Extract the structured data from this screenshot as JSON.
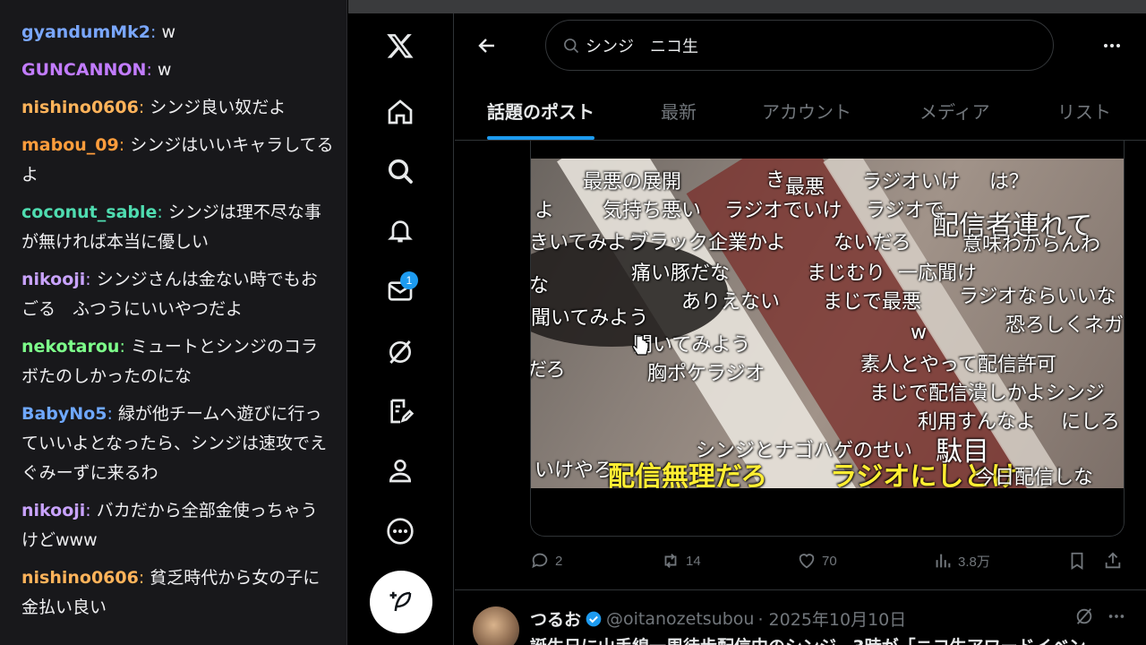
{
  "chat": {
    "messages": [
      {
        "user": "gyandumMk2",
        "text": " w",
        "color": "#7aa7ff"
      },
      {
        "user": "GUNCANNON",
        "text": " w",
        "color": "#c27cff"
      },
      {
        "user": "nishino0606",
        "text": " シンジ良い奴だよ",
        "color": "#ffb35a"
      },
      {
        "user": "mabou_09",
        "text": " シンジはいいキャラしてるよ",
        "color": "#ff9d3c"
      },
      {
        "user": "coconut_sable",
        "text": " シンジは理不尽な事が無ければ本当に優しい",
        "color": "#4fdcb0"
      },
      {
        "user": "nikooji",
        "text": " シンジさんは金ない時でもおごる　ふつうにいいやつだよ",
        "color": "#c9a3ff"
      },
      {
        "user": "nekotarou",
        "text": " ミュートとシンジのコラボたのしかったのにな",
        "color": "#7dff8a"
      },
      {
        "user": "BabyNo5",
        "text": " 緑が他チームへ遊びに行っていいよとなったら、シンジは速攻でえぐみーずに来るわ",
        "color": "#6fa8ff"
      },
      {
        "user": "nikooji",
        "text": " バカだから全部金使っちゃうけどwww",
        "color": "#c9a3ff"
      },
      {
        "user": "nishino0606",
        "text": " 貧乏時代から女の子に金払い良い",
        "color": "#ffb35a"
      }
    ]
  },
  "nav": {
    "logo": "x-logo-icon",
    "items": [
      "home-icon",
      "search-icon",
      "bell-icon",
      "mail-icon",
      "grok-icon",
      "compose-list-icon",
      "profile-icon",
      "more-icon"
    ],
    "mail_badge": "1"
  },
  "search": {
    "value": "シンジ　ニコ生"
  },
  "tabs": [
    {
      "label": "話題のポスト",
      "active": true
    },
    {
      "label": "最新",
      "active": false
    },
    {
      "label": "アカウント",
      "active": false
    },
    {
      "label": "メディア",
      "active": false
    },
    {
      "label": "リスト",
      "active": false
    }
  ],
  "video": {
    "comments": [
      "最悪の展開",
      "き",
      "最悪",
      "ラジオいけ",
      "は？",
      "配信者連れて",
      "よ",
      "気持ち悪い",
      "ラジオでいけ",
      "ラジオで",
      "きいてみよう",
      "ブラック企業かよ",
      "ないだろ",
      "意味わからんわ",
      "痛い豚だな",
      "まじむり",
      "一応聞け",
      "な",
      "ありえない",
      "まじで最悪",
      "ラジオならいいな",
      "恐ろしくネガ",
      "聞いてみよう",
      "w",
      "聞いてみよう",
      "胸ポケラジオ",
      "だろ",
      "素人とやって配信許可",
      "まじで配信潰しかよシンジ",
      "利用すんなよ",
      "にしろ",
      "シンジとナゴハゲのせい",
      "駄目",
      "いけやろ",
      "配信無理だろ",
      "ラジオにしとけ",
      "今日配信しな"
    ]
  },
  "post": {
    "replies": "2",
    "reposts": "14",
    "likes": "70",
    "views": "3.8万"
  },
  "next_post": {
    "name": "つるお",
    "handle": "@oitanozetsubou",
    "date": "· 2025年10月10日",
    "text": "誕生日に山手線一周徒歩配信中のシンジ、3時が「ニコ生アワードイベン"
  },
  "colors": {
    "accent": "#1d9bf0",
    "background": "#000000",
    "chat_bg": "#18181b"
  }
}
